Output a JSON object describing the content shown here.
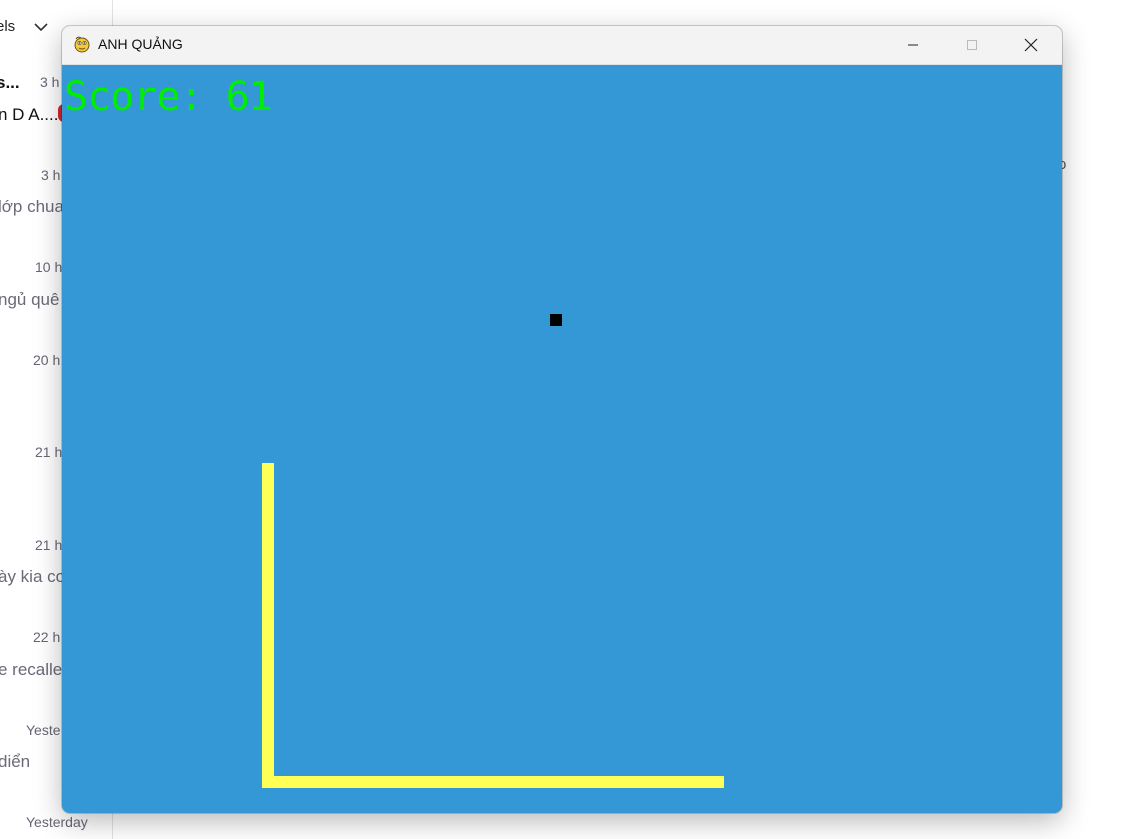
{
  "background": {
    "header_label": "els",
    "right_fragment": "o",
    "items": [
      {
        "time": "3 h",
        "preview": "s..."
      },
      {
        "time": "",
        "preview": "n D A...."
      },
      {
        "time": "3 h",
        "preview": "lớp chua"
      },
      {
        "time": "10 h",
        "preview": "ngủ quê"
      },
      {
        "time": "20 h",
        "preview": ""
      },
      {
        "time": "21 h",
        "preview": ""
      },
      {
        "time": "21 h",
        "preview": "ày kia co"
      },
      {
        "time": "22 h",
        "preview": "e recalle"
      },
      {
        "time": "Yeste",
        "preview": "diển"
      },
      {
        "time": "Yesterday",
        "preview": ""
      }
    ]
  },
  "window": {
    "title": "ANH QUẢNG",
    "controls": {
      "minimize": "minimize-icon",
      "maximize": "maximize-icon",
      "close": "close-icon"
    }
  },
  "game": {
    "score_text": "Score: 61",
    "colors": {
      "background": "#3498d6",
      "snake": "#ffff55",
      "food": "#000000",
      "score": "#00ee00"
    }
  }
}
